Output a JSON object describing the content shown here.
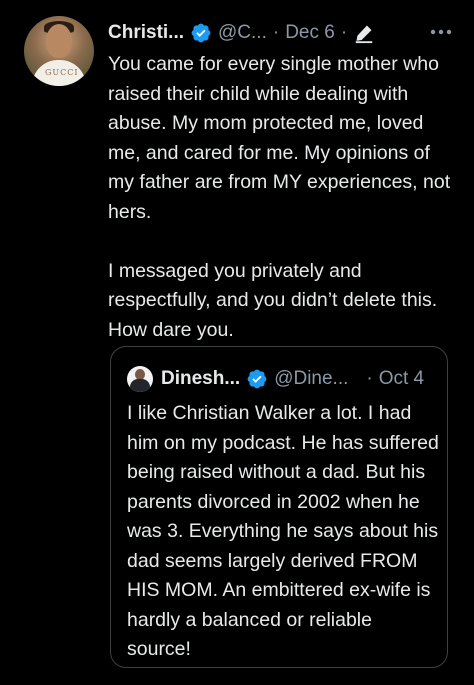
{
  "tweet": {
    "author_name": "Christi...",
    "handle": "@C...",
    "separator": "·",
    "date": "Dec 6",
    "separator_after_date": "·",
    "avatar_brand": "GUCCI",
    "paragraphs": [
      "You came for every single mother who raised their child while dealing with abuse. My mom protected me, loved me, and cared for me. My opinions of my father are from MY experiences, not hers.",
      "I messaged you privately and respectfully, and you didn’t delete this. How dare you."
    ],
    "icons": {
      "verified": "verified-badge-icon",
      "edited": "pencil-edit-icon",
      "more": "more-dots-icon"
    }
  },
  "quoted_tweet": {
    "author_name": "Dinesh...",
    "handle": "@Dine...",
    "separator": "·",
    "date": "Oct 4",
    "text": "I like Christian Walker a lot. I had him on my podcast. He has suffered being raised without a dad. But his parents divorced in 2002 when he was 3. Everything he says about his dad seems largely derived FROM HIS MOM. An embittered ex-wife is hardly a balanced or reliable source!"
  },
  "colors": {
    "background": "#000000",
    "text_primary": "#e7e9ea",
    "text_secondary": "#8b98a5",
    "verified_blue": "#1d9bf0",
    "border": "#3e4144"
  }
}
